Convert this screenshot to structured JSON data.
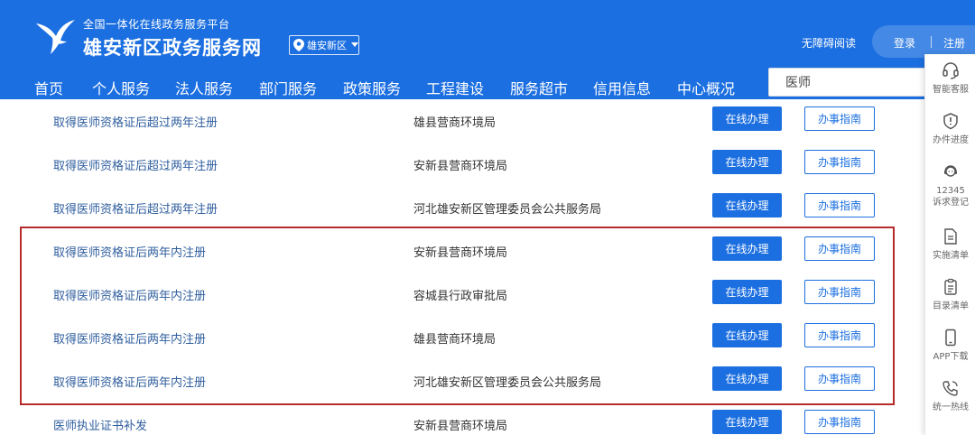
{
  "header": {
    "subtitle": "全国一体化在线政务服务平台",
    "title": "雄安新区政务服务网",
    "region": "雄安新区",
    "accessibility": "无障碍阅读",
    "login": "登录",
    "register": "注册"
  },
  "nav": {
    "items": [
      "首页",
      "个人服务",
      "法人服务",
      "部门服务",
      "政策服务",
      "工程建设",
      "服务超市",
      "信用信息",
      "中心概况"
    ]
  },
  "search": {
    "value": "医师"
  },
  "buttons": {
    "online": "在线办理",
    "guide": "办事指南"
  },
  "rows": [
    {
      "name": "取得医师资格证后超过两年注册",
      "dept": "雄县营商环境局"
    },
    {
      "name": "取得医师资格证后超过两年注册",
      "dept": "安新县营商环境局"
    },
    {
      "name": "取得医师资格证后超过两年注册",
      "dept": "河北雄安新区管理委员会公共服务局"
    },
    {
      "name": "取得医师资格证后两年内注册",
      "dept": "安新县营商环境局"
    },
    {
      "name": "取得医师资格证后两年内注册",
      "dept": "容城县行政审批局"
    },
    {
      "name": "取得医师资格证后两年内注册",
      "dept": "雄县营商环境局"
    },
    {
      "name": "取得医师资格证后两年内注册",
      "dept": "河北雄安新区管理委员会公共服务局"
    },
    {
      "name": "医师执业证书补发",
      "dept": "安新县营商环境局"
    }
  ],
  "sidebar": {
    "items": [
      {
        "label": "智能客服",
        "icon": "headset-icon"
      },
      {
        "label": "办件进度",
        "icon": "shield-icon"
      },
      {
        "label": "12345",
        "label2": "诉求登记",
        "icon": "support-agent-icon"
      },
      {
        "label": "实施清单",
        "icon": "document-icon"
      },
      {
        "label": "目录清单",
        "icon": "clipboard-icon"
      },
      {
        "label": "APP下载",
        "icon": "phone-icon"
      },
      {
        "label": "统一热线",
        "icon": "hotline-icon"
      }
    ]
  },
  "colors": {
    "primary": "#1c6fe0",
    "highlight_border": "#b72a2a",
    "link": "#2f5e9e"
  }
}
